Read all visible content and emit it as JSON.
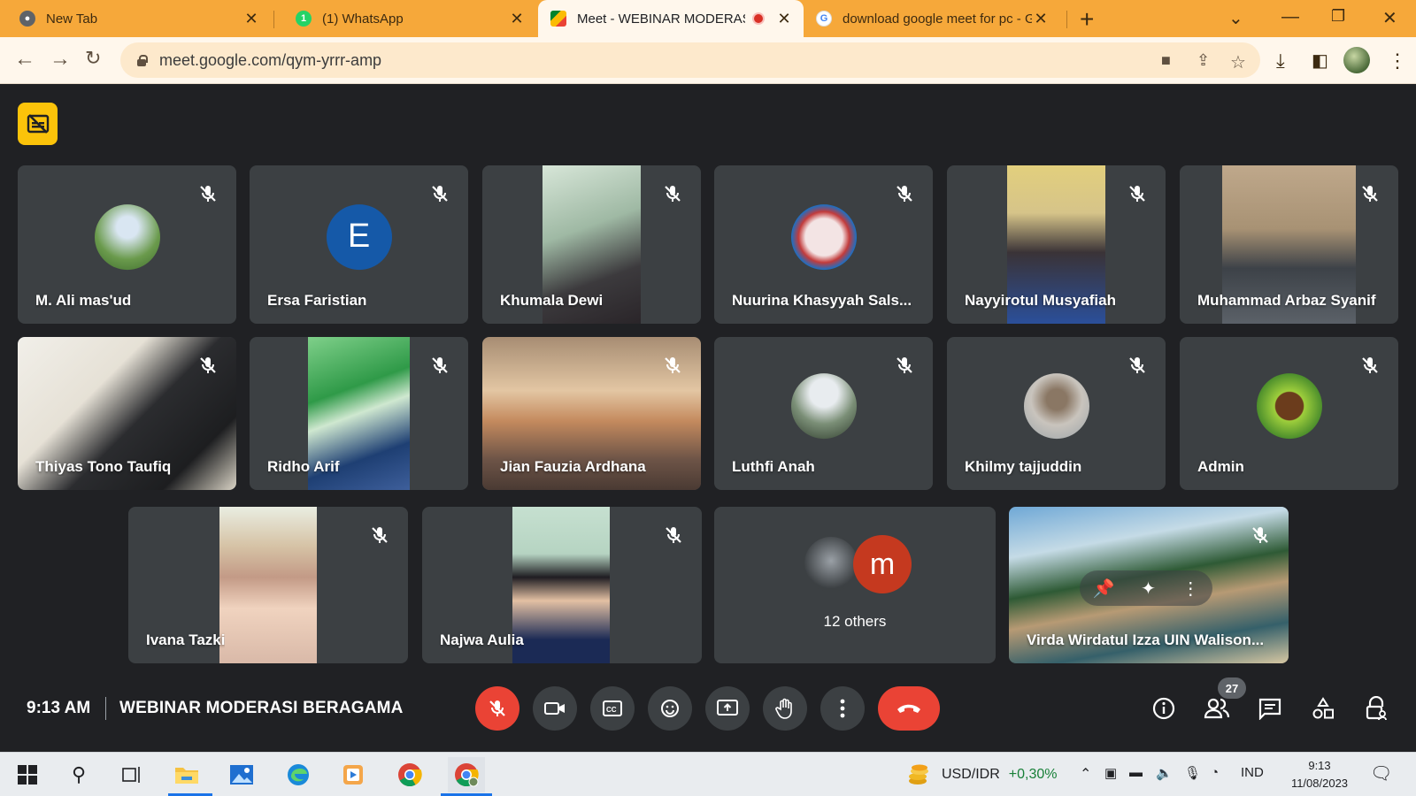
{
  "browser": {
    "tabs": [
      {
        "title": "New Tab",
        "icon": "chrome-icon"
      },
      {
        "title": "(1) WhatsApp",
        "icon": "whatsapp-icon"
      },
      {
        "title": "Meet - WEBINAR MODERASI",
        "icon": "meet-icon",
        "active": true,
        "recording": true
      },
      {
        "title": "download google meet for pc - G",
        "icon": "google-icon"
      }
    ],
    "url": "meet.google.com/qym-yrrr-amp",
    "accent_color": "#f6a83a"
  },
  "meet": {
    "captions_badge_color": "#fbc30a",
    "participants": [
      {
        "name": "M. Ali mas'ud",
        "kind": "avatar-photo",
        "muted": true
      },
      {
        "name": "Ersa Faristian",
        "kind": "avatar-letter",
        "letter": "E",
        "color": "#1559a8",
        "muted": true
      },
      {
        "name": "Khumala Dewi",
        "kind": "video",
        "muted": true
      },
      {
        "name": "Nuurina Khasyyah Sals...",
        "kind": "avatar-photo",
        "muted": true
      },
      {
        "name": "Nayyirotul Musyafiah",
        "kind": "video",
        "muted": true
      },
      {
        "name": "Muhammad Arbaz Syanif",
        "kind": "video",
        "muted": true
      },
      {
        "name": "Thiyas Tono Taufiq",
        "kind": "video",
        "muted": true
      },
      {
        "name": "Ridho Arif",
        "kind": "video",
        "muted": true
      },
      {
        "name": "Jian Fauzia Ardhana",
        "kind": "video",
        "muted": true
      },
      {
        "name": "Luthfi Anah",
        "kind": "avatar-photo",
        "muted": true
      },
      {
        "name": "Khilmy tajjuddin",
        "kind": "avatar-photo",
        "muted": true
      },
      {
        "name": "Admin",
        "kind": "avatar-photo",
        "muted": true
      },
      {
        "name": "Ivana Tazki",
        "kind": "video",
        "muted": true
      },
      {
        "name": "Najwa Aulia",
        "kind": "video",
        "muted": true
      },
      {
        "name": "Virda Wirdatul Izza UIN Walison...",
        "kind": "video",
        "muted": true
      }
    ],
    "others": {
      "label": "12 others",
      "avatar_letter": "m"
    },
    "time": "9:13 AM",
    "meeting_name": "WEBINAR MODERASI BERAGAMA",
    "participant_count": "27",
    "end_call_color": "#ea4335"
  },
  "taskbar": {
    "ticker_label": "USD/IDR",
    "ticker_change": "+0,30%",
    "language": "IND",
    "time": "9:13",
    "date": "11/08/2023"
  }
}
